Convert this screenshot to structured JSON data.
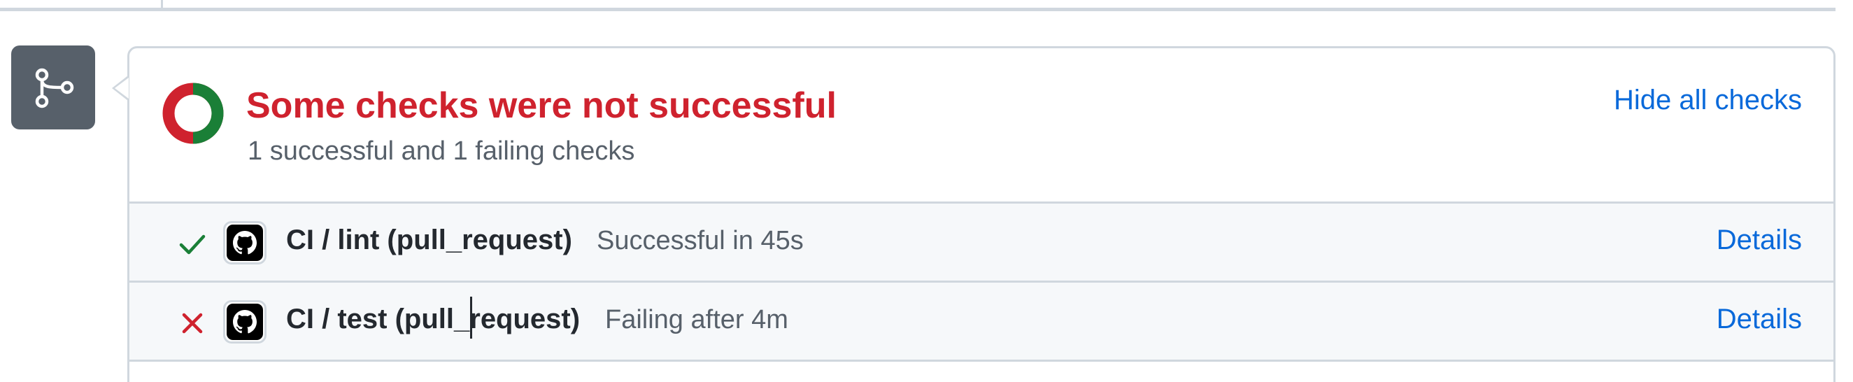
{
  "merge_box": {
    "title": "Some checks were not successful",
    "subtitle": "1 successful and 1 failing checks",
    "hide_link": "Hide all checks",
    "summary": {
      "successful": 1,
      "failing": 1
    }
  },
  "checks": [
    {
      "status": "success",
      "status_icon": "check-icon",
      "app_icon": "github-icon",
      "name": "CI / lint (pull_request)",
      "status_text": "Successful in 45s",
      "details_label": "Details"
    },
    {
      "status": "failure",
      "status_icon": "x-icon",
      "app_icon": "github-icon",
      "name": "CI / test (pull_request)",
      "status_text": "Failing after 4m",
      "details_label": "Details"
    }
  ],
  "colors": {
    "danger": "#cf222e",
    "success": "#1a7f37",
    "link": "#0969da",
    "muted": "#57606a",
    "border": "#d0d7de",
    "badge": "#57606a"
  }
}
